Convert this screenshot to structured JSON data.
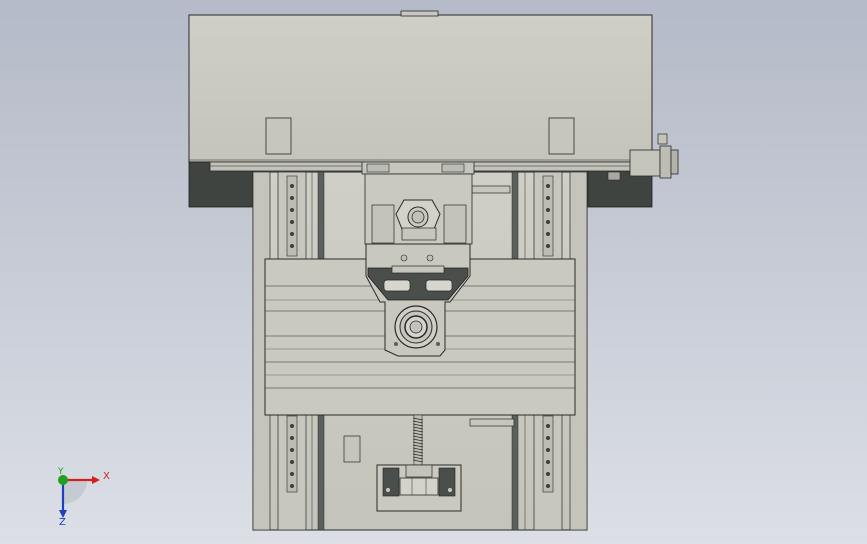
{
  "view": {
    "background_top": "#b4bac7",
    "background_bottom": "#dcdfe6",
    "body_fill": "#cbcbc2",
    "dark_fill": "#3f4441",
    "line_color": "#2a2a2a"
  },
  "triad": {
    "x_label": "X",
    "y_label": "Y",
    "z_label": "Z",
    "x_color": "#d42020",
    "y_color": "#20a020",
    "z_color": "#2040c0"
  }
}
